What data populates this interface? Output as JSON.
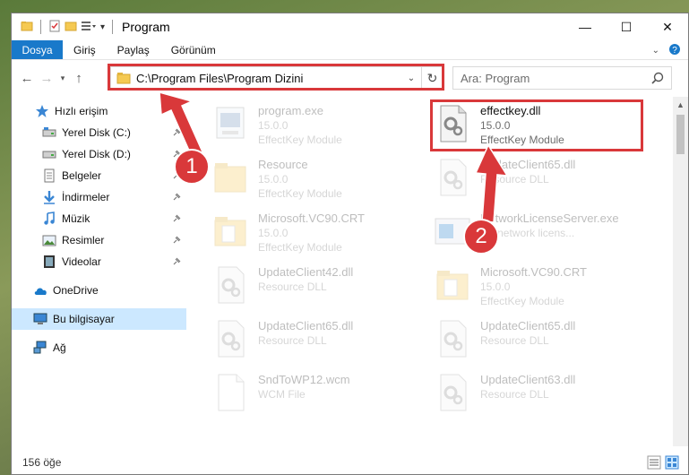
{
  "window": {
    "title": "Program",
    "controls": [
      "—",
      "☐",
      "✕"
    ]
  },
  "ribbon": {
    "tabs": [
      "Dosya",
      "Giriş",
      "Paylaş",
      "Görünüm"
    ]
  },
  "nav": {
    "address": "C:\\Program Files\\Program Dizini",
    "search_placeholder": "Ara: Program"
  },
  "sidebar": {
    "items": [
      {
        "label": "Hızlı erişim",
        "icon": "star-icon"
      },
      {
        "label": "Yerel Disk (C:)",
        "icon": "drive-icon"
      },
      {
        "label": "Yerel Disk (D:)",
        "icon": "drive-icon"
      },
      {
        "label": "Belgeler",
        "icon": "documents-icon"
      },
      {
        "label": "İndirmeler",
        "icon": "download-icon"
      },
      {
        "label": "Müzik",
        "icon": "music-icon"
      },
      {
        "label": "Resimler",
        "icon": "pictures-icon"
      },
      {
        "label": "Videolar",
        "icon": "videos-icon"
      },
      {
        "label": "OneDrive",
        "icon": "cloud-icon"
      },
      {
        "label": "Bu bilgisayar",
        "icon": "computer-icon"
      },
      {
        "label": "Ağ",
        "icon": "network-icon"
      }
    ]
  },
  "files": [
    {
      "name": "program.exe",
      "line1": "15.0.0",
      "line2": "EffectKey Module",
      "icon": "exe-icon",
      "faded": true
    },
    {
      "name": "effectkey.dll",
      "line1": "15.0.0",
      "line2": "EffectKey Module",
      "icon": "dll-icon",
      "faded": false
    },
    {
      "name": "Resource",
      "line1": "15.0.0",
      "line2": "EffectKey Module",
      "icon": "folder-icon",
      "faded": true
    },
    {
      "name": "UpdateClient65.dll",
      "line1": "Resource DLL",
      "line2": "",
      "icon": "dll-icon",
      "faded": true
    },
    {
      "name": "Microsoft.VC90.CRT",
      "line1": "15.0.0",
      "line2": "EffectKey Module",
      "icon": "folder-icon",
      "faded": true
    },
    {
      "name": "NetworkLicenseServer.exe",
      "line1": "EY network licens...",
      "line2": "",
      "icon": "app-icon",
      "faded": true
    },
    {
      "name": "UpdateClient42.dll",
      "line1": "Resource DLL",
      "line2": "",
      "icon": "dll-icon",
      "faded": true
    },
    {
      "name": "Microsoft.VC90.CRT",
      "line1": "15.0.0",
      "line2": "EffectKey Module",
      "icon": "folder-icon",
      "faded": true
    },
    {
      "name": "UpdateClient65.dll",
      "line1": "Resource DLL",
      "line2": "",
      "icon": "dll-icon",
      "faded": true
    },
    {
      "name": "UpdateClient65.dll",
      "line1": "Resource DLL",
      "line2": "",
      "icon": "dll-icon",
      "faded": true
    },
    {
      "name": "SndToWP12.wcm",
      "line1": "WCM File",
      "line2": "",
      "icon": "file-icon",
      "faded": true
    },
    {
      "name": "UpdateClient63.dll",
      "line1": "Resource DLL",
      "line2": "",
      "icon": "dll-icon",
      "faded": true
    }
  ],
  "status": {
    "count": "156 öğe"
  },
  "annotations": {
    "one": "1",
    "two": "2",
    "color": "#d9383a"
  }
}
